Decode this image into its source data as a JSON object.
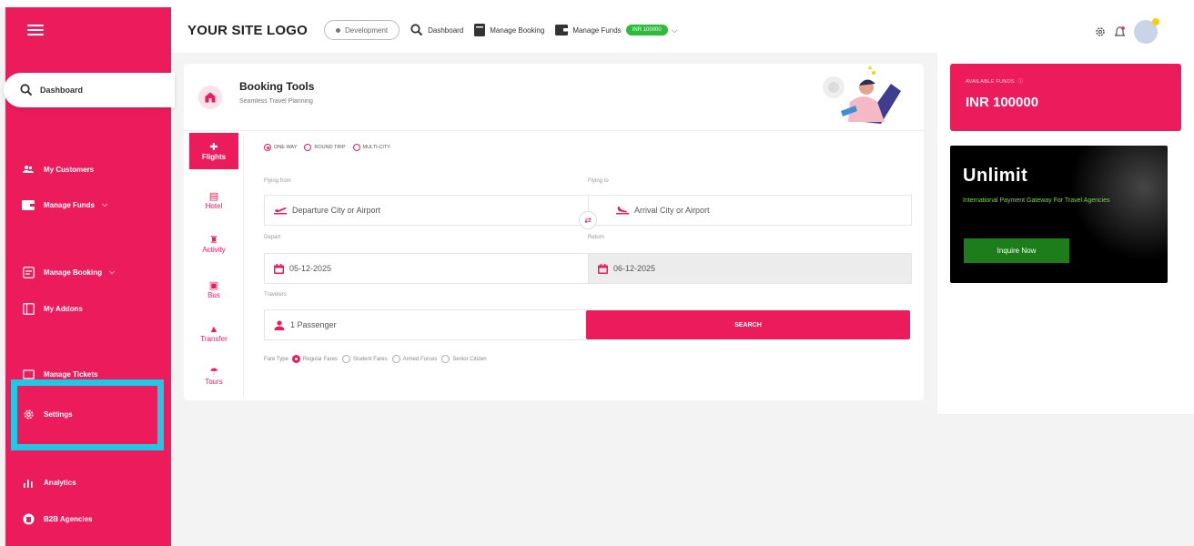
{
  "header": {
    "logo": "YOUR SITE LOGO",
    "env_label": "Development",
    "nav": {
      "dashboard": "Dashboard",
      "manage_booking": "Manage Booking",
      "manage_funds": "Manage Funds",
      "funds_badge": "INR 100000"
    }
  },
  "sidebar": {
    "dashboard": "Dashboard",
    "items": {
      "my_customers": "My Customers",
      "manage_funds": "Manage Funds",
      "manage_booking": "Manage Booking",
      "my_addons": "My Addons",
      "manage_tickets": "Manage Tickets",
      "settings": "Settings",
      "analytics": "Analytics",
      "b2b_agencies": "B2B Agencies"
    }
  },
  "booking": {
    "title": "Booking Tools",
    "subtitle": "Seamless Travel Planning",
    "tabs": [
      "Flights",
      "Hotel",
      "Activity",
      "Bus",
      "Transfer",
      "Tours"
    ],
    "trip_types": [
      "ONE WAY",
      "ROUND TRIP",
      "MULTI-CITY"
    ],
    "form": {
      "flying_from_label": "Flying from",
      "flying_from_placeholder": "Departure City or Airport",
      "flying_to_label": "Flying to",
      "flying_to_placeholder": "Arrival City or Airport",
      "depart_label": "Depart",
      "depart_value": "05-12-2025",
      "return_label": "Return",
      "return_value": "06-12-2025",
      "travelers_label": "Travelers",
      "travelers_value": "1 Passenger",
      "search_label": "SEARCH"
    },
    "fare": {
      "label": "Fare Type",
      "options": [
        "Regular Fares",
        "Student Fares",
        "Armed Forces",
        "Senior Citizen"
      ]
    }
  },
  "funds": {
    "label": "AVAILABLE FUNDS",
    "value": "INR 100000"
  },
  "ad": {
    "title": "Unlimit",
    "subtitle": "International Payment Gateway For Travel Agencies",
    "button": "Inquire Now"
  },
  "colors": {
    "brand": "#ec1c5c",
    "highlight": "#1ec9e6",
    "success": "#2dbb3c"
  }
}
